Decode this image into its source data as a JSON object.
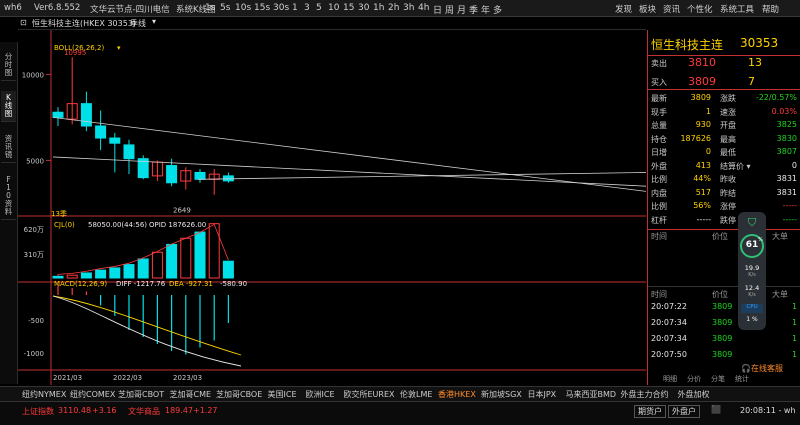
{
  "topbar": {
    "app_name": "wh6",
    "version": "Ver6.8.552",
    "node": "文华云节点-四川电信",
    "system_kline": "系统K线图",
    "periods": [
      "1s",
      "5s",
      "10s",
      "15s",
      "30s",
      "1",
      "3",
      "5",
      "10",
      "15",
      "30",
      "1h",
      "2h",
      "3h",
      "4h",
      "日",
      "周",
      "月",
      "季",
      "年",
      "多"
    ],
    "menu": [
      "发现",
      "板块",
      "资讯",
      "个性化",
      "系统工具",
      "帮助"
    ]
  },
  "left_tabs": [
    "分时图",
    "K线图",
    "资讯镜",
    "F10资料"
  ],
  "chart": {
    "header_title": "恒生科技主连(HKEX 30353)",
    "period_label": "季线",
    "boll": {
      "label": "BOLL(26,26,2)"
    },
    "price_ticks": [
      "10000",
      "5000"
    ],
    "high_label": "10995",
    "low_label": "2649",
    "bar_count": "13季",
    "candles": [
      {
        "o": 7800,
        "h": 8100,
        "l": 7000,
        "c": 7500
      },
      {
        "o": 7400,
        "h": 11000,
        "l": 7100,
        "c": 8300
      },
      {
        "o": 8300,
        "h": 9000,
        "l": 6700,
        "c": 7000
      },
      {
        "o": 7000,
        "h": 7900,
        "l": 5600,
        "c": 6300
      },
      {
        "o": 6300,
        "h": 6600,
        "l": 4300,
        "c": 6000
      },
      {
        "o": 5900,
        "h": 6200,
        "l": 4200,
        "c": 5100
      },
      {
        "o": 5100,
        "h": 5300,
        "l": 3900,
        "c": 4000
      },
      {
        "o": 4100,
        "h": 5000,
        "l": 3800,
        "c": 4900
      },
      {
        "o": 4700,
        "h": 5100,
        "l": 3500,
        "c": 3700
      },
      {
        "o": 3800,
        "h": 4600,
        "l": 3300,
        "c": 4400
      },
      {
        "o": 4300,
        "h": 4500,
        "l": 3700,
        "c": 3900
      },
      {
        "o": 3900,
        "h": 4500,
        "l": 3000,
        "c": 4200
      },
      {
        "o": 4100,
        "h": 4300,
        "l": 3700,
        "c": 3810
      }
    ],
    "vol": {
      "label": "CJL(0)",
      "cjl": "58050.00(44:56)",
      "opid": "OPID 187626.00",
      "ticks": [
        "620万",
        "310万"
      ]
    },
    "volumes": [
      0.03,
      0.05,
      0.09,
      0.14,
      0.18,
      0.24,
      0.34,
      0.46,
      0.6,
      0.71,
      0.82,
      0.97,
      0.3
    ],
    "macd": {
      "label": "MACD(12,26,9)",
      "diff": "DIFF -1217.76",
      "dea": "DEA -927.31",
      "value": "-580.90",
      "ticks": [
        "-500",
        "-1000"
      ]
    },
    "macd_bars": [
      0.15,
      0.1,
      0.05,
      -0.15,
      -0.3,
      -0.5,
      -0.6,
      -0.7,
      -0.8,
      -0.85,
      -0.75,
      -0.65,
      -0.4
    ],
    "dates": [
      "2021/03",
      "2022/03",
      "2023/03"
    ]
  },
  "right": {
    "title": "恒生科技主连",
    "code": "30353",
    "sell_label": "卖出",
    "sell_price": "3810",
    "sell_qty": "13",
    "buy_label": "买入",
    "buy_price": "3809",
    "buy_qty": "7",
    "rows": [
      {
        "l1": "最新",
        "v1": "3809",
        "c1": "yellow",
        "l2": "涨跌",
        "v2": "-22/0.57%",
        "c2": "green"
      },
      {
        "l1": "现手",
        "v1": "1",
        "c1": "yellow",
        "l2": "速涨",
        "v2": "0.03%",
        "c2": "red"
      },
      {
        "l1": "总量",
        "v1": "930",
        "c1": "yellow",
        "l2": "开盘",
        "v2": "3825",
        "c2": "green"
      },
      {
        "l1": "持仓",
        "v1": "187626",
        "c1": "yellow",
        "l2": "最高",
        "v2": "3830",
        "c2": "green"
      },
      {
        "l1": "日增",
        "v1": "0",
        "c1": "yellow",
        "l2": "最低",
        "v2": "3807",
        "c2": "green"
      },
      {
        "l1": "外盘",
        "v1": "413",
        "c1": "yellow",
        "l2": "结算价 ▾",
        "v2": "0",
        "c2": "white"
      },
      {
        "l1": "比例",
        "v1": "44%",
        "c1": "yellow",
        "l2": "昨收",
        "v2": "3831",
        "c2": "white"
      },
      {
        "l1": "内盘",
        "v1": "517",
        "c1": "yellow",
        "l2": "昨结",
        "v2": "3831",
        "c2": "white"
      },
      {
        "l1": "比例",
        "v1": "56%",
        "c1": "yellow",
        "l2": "涨停",
        "v2": "-----",
        "c2": "red"
      },
      {
        "l1": "杠杆",
        "v1": "-----",
        "c1": "white",
        "l2": "跌停",
        "v2": "-----",
        "c2": "green"
      }
    ],
    "trade_headers": [
      "时间",
      "价位",
      "现手",
      "大单"
    ],
    "trades_top": [],
    "trades": [
      {
        "t": "20:07:22",
        "p": "3809",
        "q": "1"
      },
      {
        "t": "20:07:34",
        "p": "3809",
        "q": "1"
      },
      {
        "t": "20:07:34",
        "p": "3809",
        "q": "1"
      },
      {
        "t": "20:07:50",
        "p": "3809",
        "q": "1"
      }
    ],
    "gauge": {
      "value": "61",
      "unit": "%",
      "up": "19.9",
      "up_unit": "K/s",
      "down": "12.4",
      "down_unit": "K/s",
      "cpu": "CPU",
      "cpu_val": "1 %"
    },
    "online": "在线客服",
    "bottom_tabs": [
      "明细",
      "分价",
      "分笔",
      "统计"
    ]
  },
  "exchanges": [
    "纽约NYMEX",
    "纽约COMEX",
    "芝加哥CBOT",
    "芝加哥CME",
    "芝加哥CBOE",
    "美国ICE",
    "欧洲ICE",
    "欧交所EUREX",
    "伦敦LME",
    "香港HKEX",
    "新加坡SGX",
    "日本JPX",
    "马来西亚BMD",
    "外盘主力合约",
    "外盘加权"
  ],
  "status": {
    "idx1_name": "上证指数",
    "idx1_val": "3110.48",
    "idx1_chg": "+3.16",
    "idx2_name": "文华商品",
    "idx2_val": "189.47",
    "idx2_chg": "+1.27",
    "acct_btn": "期货户",
    "ext_btn": "外盘户",
    "time": "20:08:11 - wh"
  },
  "colors": {
    "up": "#ff3b3b",
    "down": "#00ffff",
    "green": "#22d322",
    "yellow": "#ffd200",
    "accent": "#c23030"
  }
}
